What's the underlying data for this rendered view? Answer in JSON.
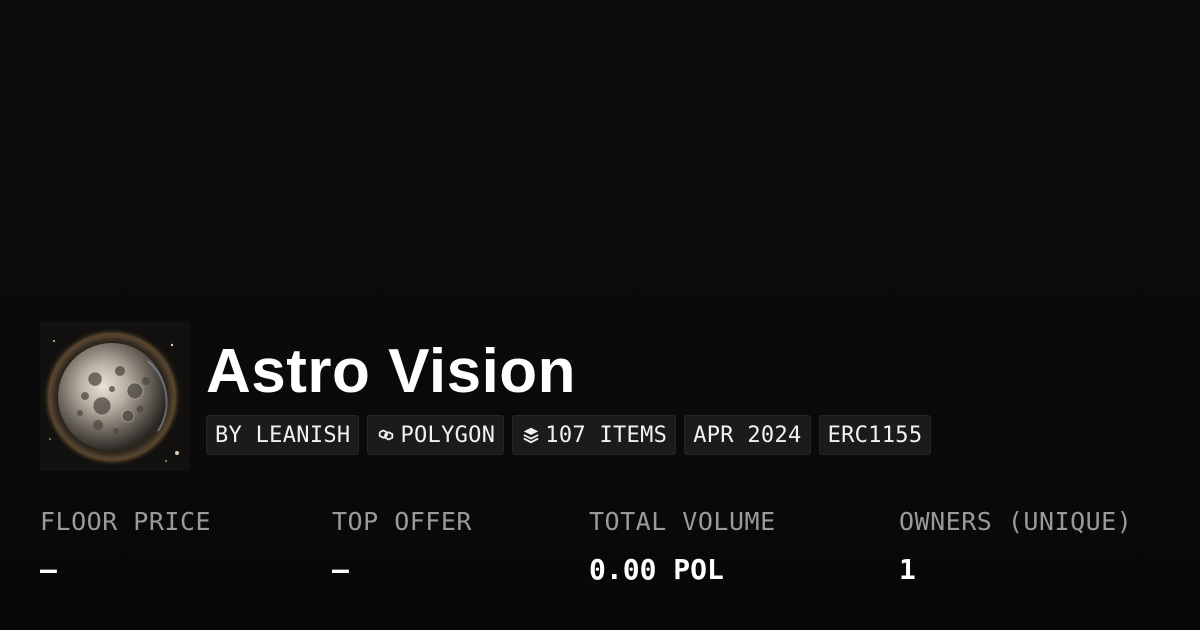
{
  "collection": {
    "name": "Astro Vision",
    "image_alt": "moon-artwork"
  },
  "tags": {
    "creator": "BY LEANISH",
    "chain": "POLYGON",
    "chain_icon": "polygon-chain-icon",
    "items": "107 ITEMS",
    "items_icon": "layers-icon",
    "date": "APR 2024",
    "standard": "ERC1155"
  },
  "stats": {
    "floor_price": {
      "label": "FLOOR PRICE",
      "value": "—"
    },
    "top_offer": {
      "label": "TOP OFFER",
      "value": "—"
    },
    "total_volume": {
      "label": "TOTAL VOLUME",
      "value": "0.00 POL"
    },
    "owners": {
      "label": "OWNERS (UNIQUE)",
      "value": "1"
    }
  },
  "colors": {
    "background": "#0b0b0b",
    "tag_background": "#1b1b1b",
    "label_gray": "#9a9a9a",
    "text": "#ffffff"
  }
}
